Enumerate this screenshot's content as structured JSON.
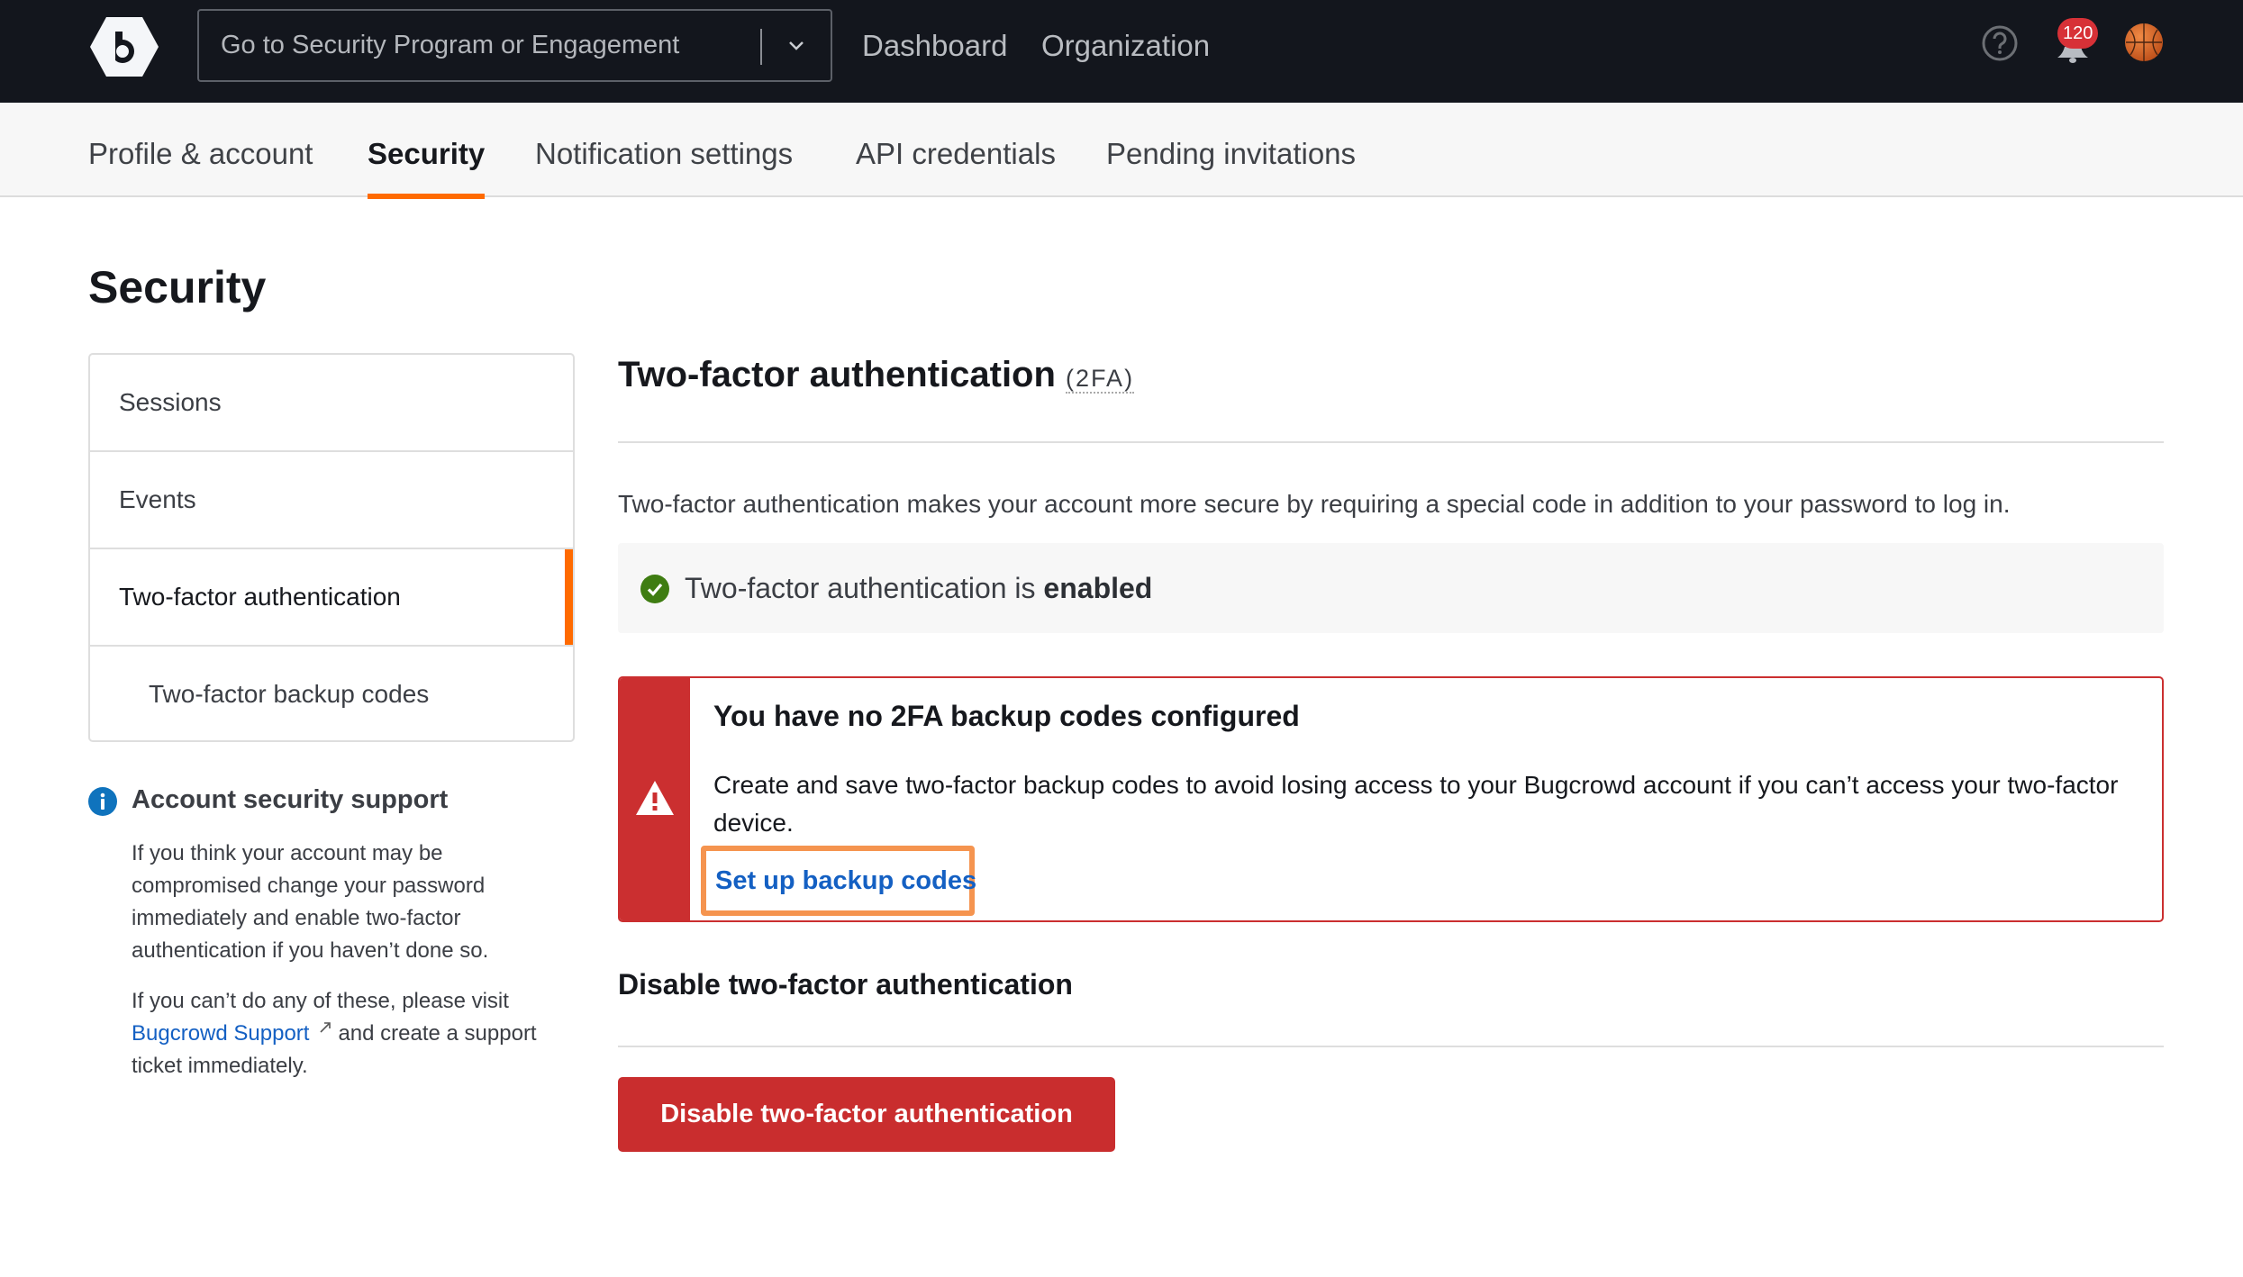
{
  "topnav": {
    "logo_letter": "b",
    "program_select_placeholder": "Go to Security Program or Engagement",
    "links": [
      {
        "label": "Dashboard"
      },
      {
        "label": "Organization"
      }
    ],
    "help_icon": "question-circle-icon",
    "notifications": {
      "icon": "bell-icon",
      "count": "120"
    },
    "avatar": "basketball-avatar"
  },
  "subnav": {
    "tabs": [
      {
        "label": "Profile & account",
        "active": false
      },
      {
        "label": "Security",
        "active": true
      },
      {
        "label": "Notification settings",
        "active": false
      },
      {
        "label": "API credentials",
        "active": false
      },
      {
        "label": "Pending invitations",
        "active": false
      }
    ]
  },
  "page": {
    "title": "Security"
  },
  "sidemenu": {
    "items": [
      {
        "label": "Sessions",
        "active": false
      },
      {
        "label": "Events",
        "active": false
      },
      {
        "label": "Two-factor authentication",
        "active": true
      },
      {
        "label": "Two-factor backup codes",
        "active": false,
        "sub": true
      }
    ]
  },
  "support": {
    "title": "Account security support",
    "p1": "If you think your account may be compromised change your password immediately and enable two-factor authentication if you haven’t done so.",
    "p2_before": "If you can’t do any of these, please visit ",
    "p2_link": "Bugcrowd Support",
    "p2_after": "and create a support ticket immediately."
  },
  "main": {
    "title": "Two-factor authentication",
    "title_abbr": "(2FA)",
    "intro": "Two-factor authentication makes your account more secure by requiring a special code in addition to your password to log in.",
    "status_prefix": "Two-factor authentication is ",
    "status_value": "enabled",
    "alert": {
      "title": "You have no 2FA backup codes configured",
      "body": "Create and save two-factor backup codes to avoid losing access to your Bugcrowd account if you can’t access your two-factor device.",
      "link": "Set up backup codes"
    },
    "disable_heading": "Disable two-factor authentication",
    "disable_button": "Disable two-factor authentication"
  },
  "colors": {
    "accent": "#ff6a00",
    "danger": "#cb2f30",
    "link": "#1460c3",
    "success": "#3f7d12",
    "nav_bg": "#13161d",
    "highlight": "#f5944f"
  }
}
